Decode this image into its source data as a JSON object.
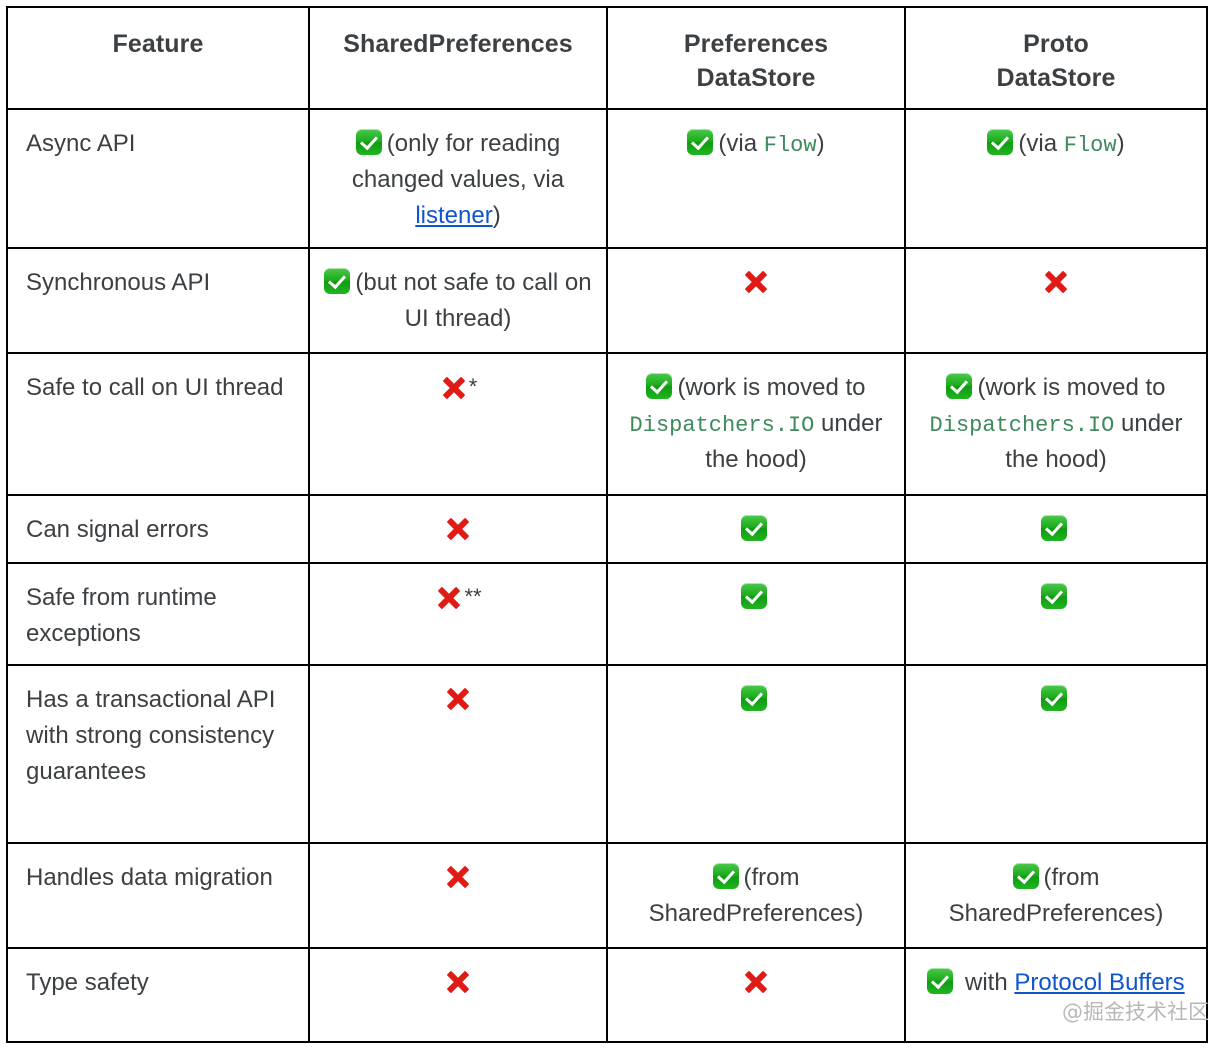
{
  "table": {
    "name": "DataStore vs SharedPreferences comparison",
    "headers": [
      {
        "label": "Feature"
      },
      {
        "label": "SharedPreferences"
      },
      {
        "label": "Preferences\nDataStore"
      },
      {
        "label": "Proto\nDataStore"
      }
    ],
    "header_labels": {
      "feature": "Feature",
      "sharedpreferences": "SharedPreferences",
      "preferences_datastore_line1": "Preferences",
      "preferences_datastore_line2": "DataStore",
      "proto_datastore_line1": "Proto",
      "proto_datastore_line2": "DataStore"
    },
    "rows": [
      {
        "feature": "Async API",
        "sharedpreferences": {
          "icon": "check-icon",
          "text_before": "(only for reading changed values, via ",
          "link": "listener",
          "text_after": ")"
        },
        "preferences_datastore": {
          "icon": "check-icon",
          "text_before": "(via ",
          "code": "Flow",
          "text_after": ")"
        },
        "proto_datastore": {
          "icon": "check-icon",
          "text_before": "(via ",
          "code": "Flow",
          "text_after": ")"
        }
      },
      {
        "feature": "Synchronous API",
        "sharedpreferences": {
          "icon": "check-icon",
          "text_before": "(but not safe to call on UI thread)"
        },
        "preferences_datastore": {
          "icon": "cross-icon"
        },
        "proto_datastore": {
          "icon": "cross-icon"
        }
      },
      {
        "feature": "Safe to call on UI thread",
        "sharedpreferences": {
          "icon": "cross-icon",
          "note": "*"
        },
        "preferences_datastore": {
          "icon": "check-icon",
          "text_before": "(work is moved to ",
          "code": "Dispatchers.IO",
          "text_after": " under the hood)"
        },
        "proto_datastore": {
          "icon": "check-icon",
          "text_before": "(work is moved to ",
          "code": "Dispatchers.IO",
          "text_after": " under the hood)"
        }
      },
      {
        "feature": "Can signal errors",
        "sharedpreferences": {
          "icon": "cross-icon"
        },
        "preferences_datastore": {
          "icon": "check-icon"
        },
        "proto_datastore": {
          "icon": "check-icon"
        }
      },
      {
        "feature": "Safe from runtime exceptions",
        "sharedpreferences": {
          "icon": "cross-icon",
          "note": "**"
        },
        "preferences_datastore": {
          "icon": "check-icon"
        },
        "proto_datastore": {
          "icon": "check-icon"
        }
      },
      {
        "feature": "Has a transactional API with strong consistency guarantees",
        "sharedpreferences": {
          "icon": "cross-icon"
        },
        "preferences_datastore": {
          "icon": "check-icon"
        },
        "proto_datastore": {
          "icon": "check-icon"
        }
      },
      {
        "feature": "Handles data migration",
        "sharedpreferences": {
          "icon": "cross-icon"
        },
        "preferences_datastore": {
          "icon": "check-icon",
          "text_before": "(from SharedPreferences)"
        },
        "proto_datastore": {
          "icon": "check-icon",
          "text_before": "(from SharedPreferences)"
        }
      },
      {
        "feature": "Type safety",
        "sharedpreferences": {
          "icon": "cross-icon"
        },
        "preferences_datastore": {
          "icon": "cross-icon"
        },
        "proto_datastore": {
          "icon": "check-icon",
          "text_before": " with ",
          "link": "Protocol Buffers"
        }
      }
    ]
  },
  "watermark": {
    "text": "@掘金技术社区"
  },
  "colors": {
    "text": "#3c4043",
    "border": "#000000",
    "check_green": "#1aab1a",
    "cross_red": "#e01b16",
    "code_green": "#3e8a5c",
    "link_blue": "#1155cc",
    "watermark": "#b8b8b8"
  }
}
